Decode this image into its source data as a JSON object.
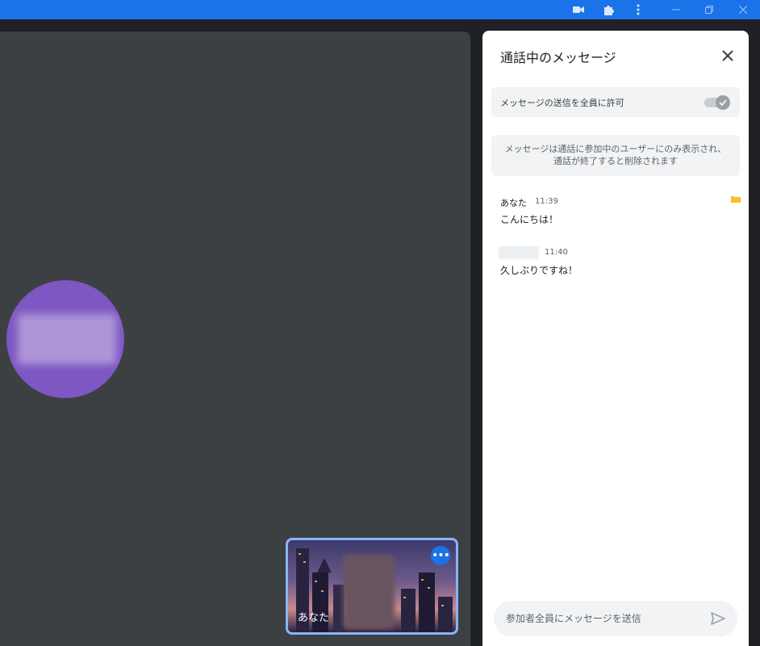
{
  "panel": {
    "title": "通話中のメッセージ",
    "allow_label": "メッセージの送信を全員に許可",
    "allow_enabled": true,
    "info_line1": "メッセージは通話に参加中のユーザーにのみ表示され、",
    "info_line2": "通話が終了すると削除されます",
    "messages": [
      {
        "sender": "あなた",
        "time": "11:39",
        "text": "こんにちは！"
      },
      {
        "sender": "",
        "time": "11:40",
        "text": "久しぶりですね！"
      }
    ],
    "compose_placeholder": "参加者全員にメッセージを送信"
  },
  "self_tile": {
    "label": "あなた"
  },
  "colors": {
    "accent": "#1a73e8",
    "stage": "#3c4043",
    "avatar": "#7e57c2"
  }
}
